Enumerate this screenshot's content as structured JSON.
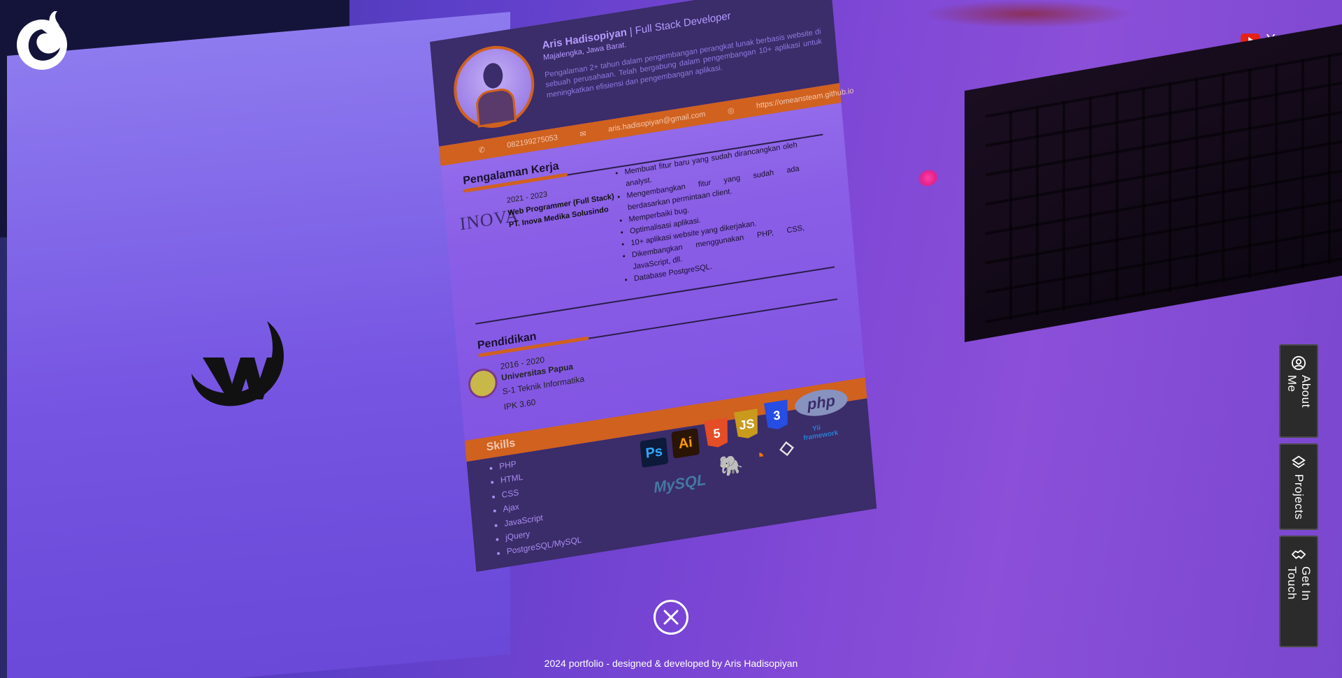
{
  "header": {
    "youtube_label": "Youtube"
  },
  "resume": {
    "name": "Aris Hadisopiyan",
    "role": " | Full Stack Developer",
    "location": "Majalengka, Jawa Barat.",
    "summary": "Pengalaman 2+ tahun dalam pengembangan perangkat lunak berbasis website di sebuah perusahaan. Telah bergabung dalam pengembangan 10+ aplikasi untuk meningkatkan efisiensi dan pengembangan aplikasi.",
    "phone": "082199275053",
    "email": "aris.hadisopiyan@gmail.com",
    "website": "https://omeansteam.github.io",
    "experience": {
      "title": "Pengalaman Kerja",
      "years": "2021 - 2023",
      "position": "Web Programmer (Full Stack)",
      "company": "PT. Inova Medika Solusindo",
      "company_logo_text": "INOVA",
      "tasks": [
        "Membuat fitur baru yang sudah dirancangkan oleh analyst.",
        "Mengembangkan fitur yang sudah ada berdasarkan permintaan client.",
        "Memperbaiki bug.",
        "Optimalisasi aplikasi.",
        "10+ aplikasi website yang dikerjakan.",
        "Dikembangkan menggunakan PHP, CSS, JavaScript, dll.",
        "Database PostgreSQL."
      ]
    },
    "education": {
      "title": "Pendidikan",
      "years": "2016 - 2020",
      "school": "Universitas Papua",
      "degree": "S-1 Teknik Informatika",
      "gpa": "IPK 3.60"
    },
    "skills": {
      "title": "Skills",
      "items": [
        "PHP",
        "HTML",
        "CSS",
        "Ajax",
        "JavaScript",
        "jQuery",
        "PostgreSQL/MySQL"
      ],
      "tech_logos": {
        "ps": "Ps",
        "ai": "Ai",
        "html": "5",
        "js": "JS",
        "css": "3",
        "php": "php",
        "mysql": "MySQL",
        "yii": "Yii framework"
      }
    }
  },
  "nav": {
    "about": "About Me",
    "projects": "Projects",
    "contact": "Get In Touch"
  },
  "footer": {
    "text": "2024 portfolio - designed & developed by Aris Hadisopiyan"
  },
  "colors": {
    "accent_orange": "#d0611f",
    "resume_header": "#3b2c6a",
    "youtube_red": "#e62117"
  },
  "icons": {
    "logo": "swan-logo-icon",
    "w_logo": "w-brand-icon",
    "close": "close-icon",
    "about": "user-circle-icon",
    "projects": "layers-icon",
    "contact": "handshake-icon"
  }
}
